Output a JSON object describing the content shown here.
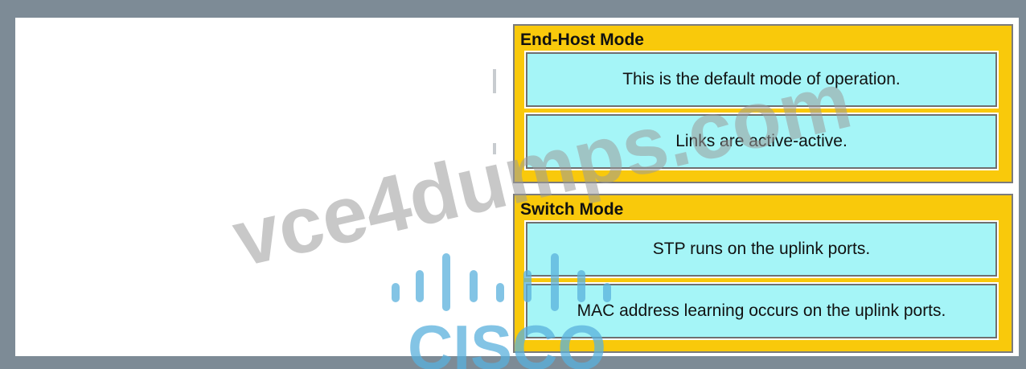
{
  "groups": [
    {
      "title": "End-Host Mode",
      "items": [
        "This is the default mode of operation.",
        "Links are active-active."
      ]
    },
    {
      "title": "Switch Mode",
      "items": [
        "STP runs on the uplink ports.",
        "MAC address learning occurs on the uplink ports."
      ]
    }
  ],
  "watermark": {
    "site": "vce4dumps.com",
    "logo": "CISCO",
    "site_color": "#9a9a9a",
    "logo_color": "#5ab0dc"
  },
  "colors": {
    "group_bg": "#f9c90b",
    "card_bg": "#a5f5f7",
    "outer_bg": "#7d8b96"
  }
}
